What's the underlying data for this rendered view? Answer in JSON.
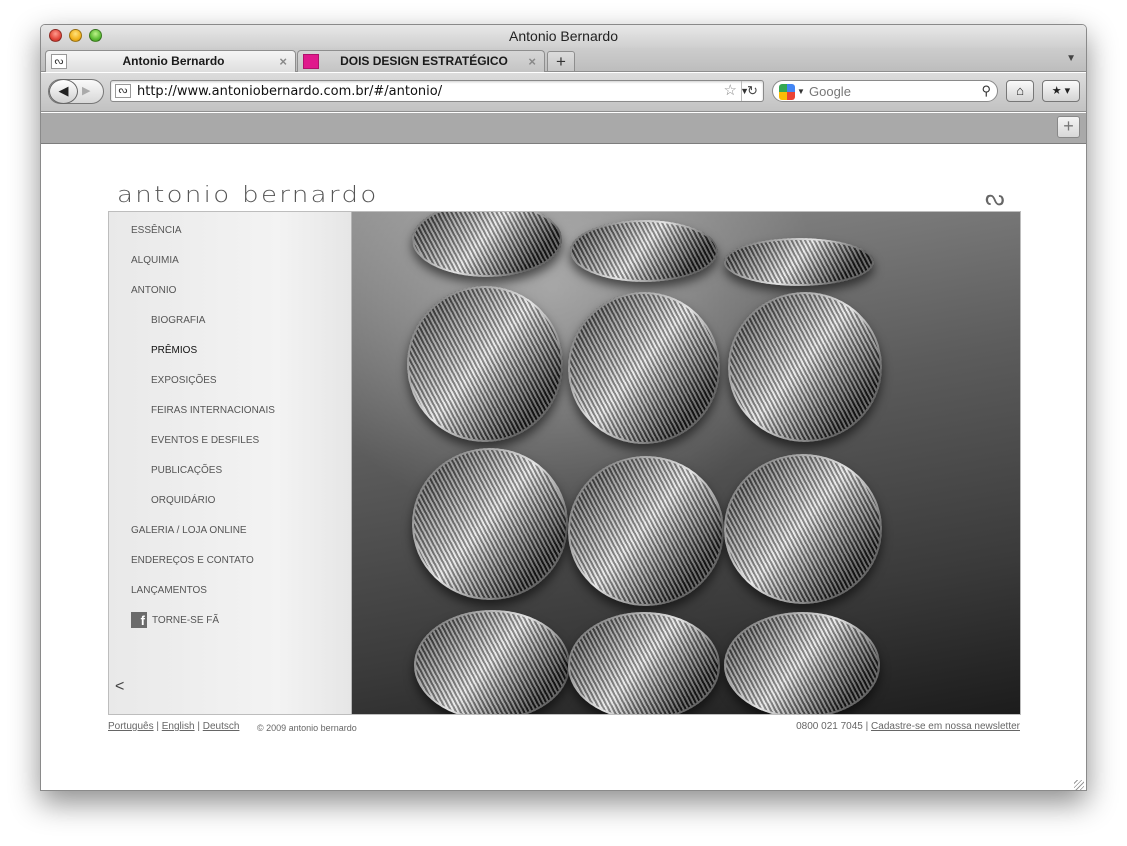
{
  "window": {
    "title": "Antonio Bernardo"
  },
  "tabs": [
    {
      "label": "Antonio Bernardo",
      "active": true
    },
    {
      "label": "DOIS DESIGN ESTRATÉGICO",
      "active": false
    }
  ],
  "toolbar": {
    "url": "http://www.antoniobernardo.com.br/#/antonio/",
    "search_placeholder": "Google"
  },
  "site": {
    "logo": "antonio bernardo",
    "menu": [
      {
        "label": "ESSÊNCIA",
        "level": 0
      },
      {
        "label": "ALQUIMIA",
        "level": 0
      },
      {
        "label": "ANTONIO",
        "level": 0
      },
      {
        "label": "BIOGRAFIA",
        "level": 1
      },
      {
        "label": "PRÊMIOS",
        "level": 1,
        "active": true
      },
      {
        "label": "EXPOSIÇÕES",
        "level": 1
      },
      {
        "label": "FEIRAS INTERNACIONAIS",
        "level": 1
      },
      {
        "label": "EVENTOS E DESFILES",
        "level": 1
      },
      {
        "label": "PUBLICAÇÕES",
        "level": 1
      },
      {
        "label": "ORQUIDÁRIO",
        "level": 1
      },
      {
        "label": "GALERIA / LOJA ONLINE",
        "level": 0
      },
      {
        "label": "ENDEREÇOS E CONTATO",
        "level": 0
      },
      {
        "label": "LANÇAMENTOS",
        "level": 0
      },
      {
        "label": "TORNE-SE FÃ",
        "level": 1
      }
    ],
    "prev_label": "<"
  },
  "footer": {
    "lang_pt": "Português",
    "lang_en": "English",
    "lang_de": "Deutsch",
    "sep": "|",
    "copyright": "© 2009 antonio bernardo",
    "phone": "0800 021 7045",
    "newsletter": "Cadastre-se em nossa newsletter"
  },
  "colors": {
    "accent_tab_favicon": "#e0198c",
    "bookmark_bar": "#a9a9a9"
  }
}
